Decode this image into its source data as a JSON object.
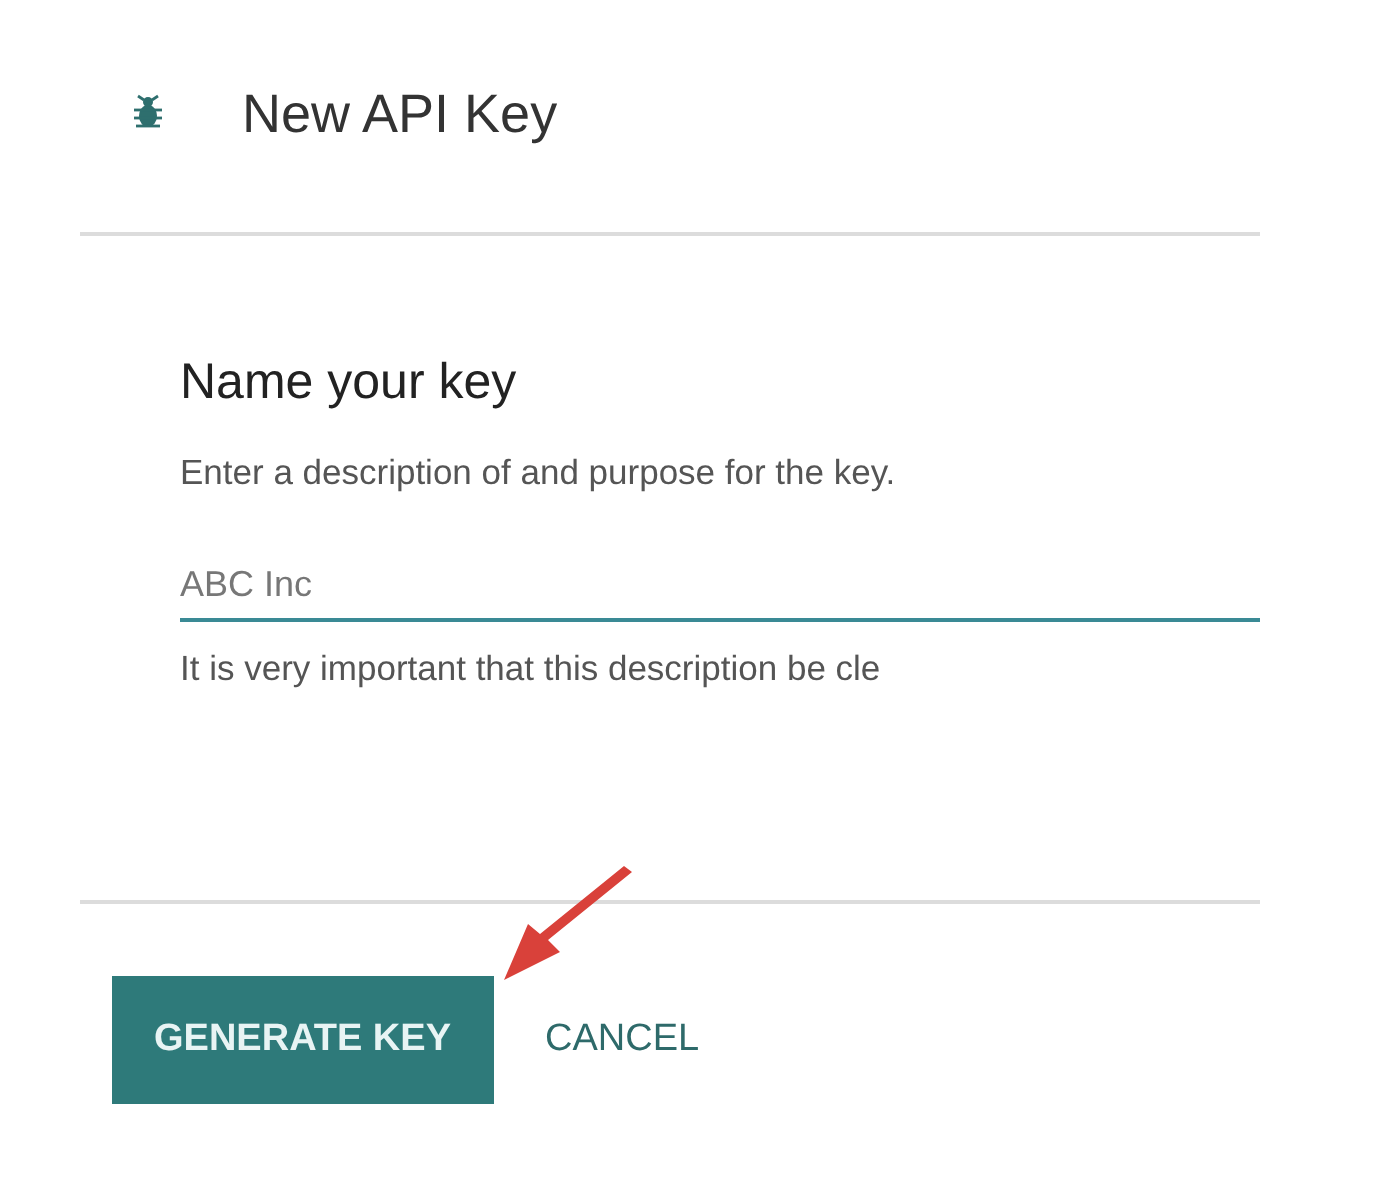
{
  "dialog": {
    "title": "New API Key"
  },
  "section": {
    "heading": "Name your key",
    "description": "Enter a description of and purpose for the key.",
    "field": {
      "value": "ABC Inc"
    },
    "helper": "It is very important that this description be cle"
  },
  "buttons": [
    {
      "label": "GENERATE KEY",
      "kind": "primary"
    },
    {
      "label": "CANCEL",
      "kind": "text"
    }
  ]
}
